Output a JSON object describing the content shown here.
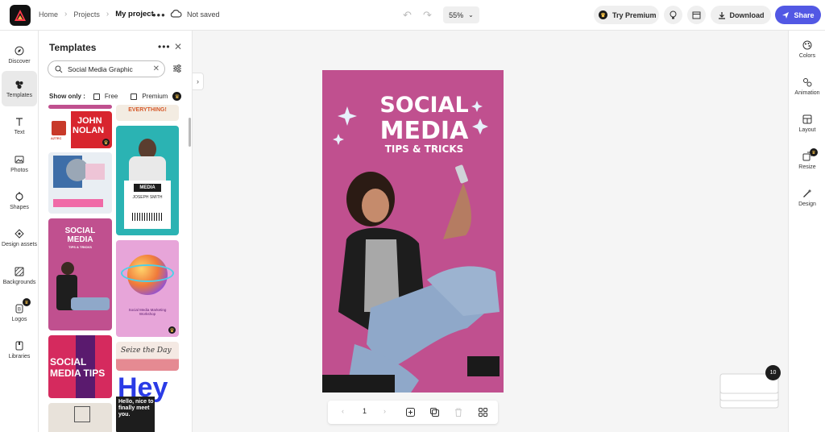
{
  "topbar": {
    "breadcrumbs": [
      "Home",
      "Projects",
      "My project"
    ],
    "status": "Not saved",
    "zoom": "55%",
    "try_premium": "Try Premium",
    "download": "Download",
    "share": "Share"
  },
  "leftrail": {
    "items": [
      "Discover",
      "Templates",
      "Text",
      "Photos",
      "Shapes",
      "Design assets",
      "Backgrounds",
      "Logos",
      "Libraries"
    ]
  },
  "panel": {
    "title": "Templates",
    "search_value": "Social Media Graphic",
    "show_only": "Show only :",
    "free": "Free",
    "premium": "Premium"
  },
  "thumbs": {
    "everything": "EVERYTHING!",
    "john": "JOHN",
    "nolan": "NOLAN",
    "aztec": "AZTEC",
    "media": "MEDIA",
    "joseph": "JOSEPH SMITH",
    "social": "SOCIAL",
    "social_media": "MEDIA",
    "tips": "TIPS & TRICKS",
    "social_media_mkt": "Social Media Marketing Workshop",
    "social2": "SOCIAL",
    "media_tips": "MEDIA TIPS",
    "seize": "Seize the Day",
    "hey": "Hey",
    "hello": "Hello, nice to finally meet you."
  },
  "artboard": {
    "line1": "SOCIAL",
    "line2": "MEDIA",
    "line3": "TIPS & TRICKS",
    "bg_color": "#c0508f"
  },
  "pagebar": {
    "page": "1"
  },
  "rightrail": {
    "items": [
      "Colors",
      "Animation",
      "Layout",
      "Resize",
      "Design"
    ]
  },
  "page_count": "10"
}
